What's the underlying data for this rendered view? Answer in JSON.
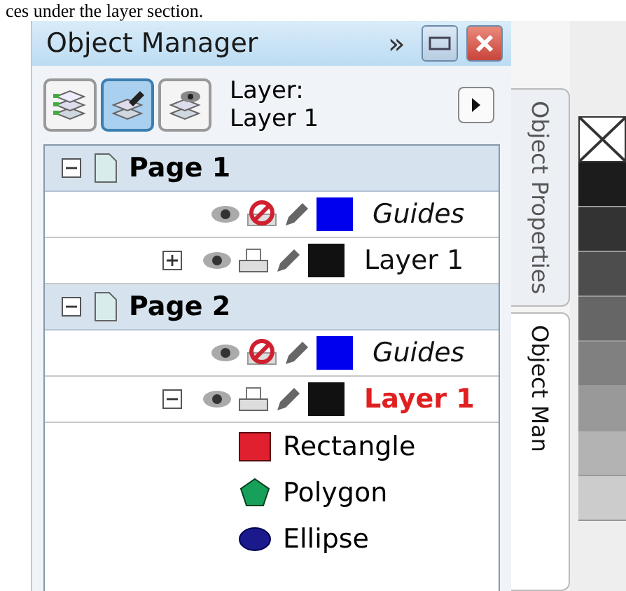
{
  "caption": "ces under the layer section.",
  "window": {
    "title": "Object Manager",
    "more": "»"
  },
  "toolbar": {
    "modes": [
      {
        "kind": "layers",
        "selected": false
      },
      {
        "kind": "edit",
        "selected": true
      },
      {
        "kind": "view",
        "selected": false
      }
    ],
    "layer_label": "Layer:",
    "layer_name": "Layer 1"
  },
  "tree": [
    {
      "name": "Page 1",
      "expanded": true,
      "children": [
        {
          "name": "Guides",
          "kind": "guides",
          "color": "#0000ee",
          "printable": false,
          "active": false
        },
        {
          "name": "Layer 1",
          "kind": "layer",
          "color": "#111111",
          "printable": true,
          "active": false,
          "expanded": false
        }
      ]
    },
    {
      "name": "Page 2",
      "expanded": true,
      "children": [
        {
          "name": "Guides",
          "kind": "guides",
          "color": "#0000ee",
          "printable": false,
          "active": false
        },
        {
          "name": "Layer 1",
          "kind": "layer",
          "color": "#111111",
          "printable": true,
          "active": true,
          "expanded": true,
          "children": [
            {
              "name": "Rectangle",
              "kind": "rectangle",
              "color": "#e0202e"
            },
            {
              "name": "Polygon",
              "kind": "polygon",
              "color": "#17a05a"
            },
            {
              "name": "Ellipse",
              "kind": "ellipse",
              "color": "#1a1a8c"
            }
          ]
        }
      ]
    }
  ],
  "side_tabs": [
    {
      "label": "Object Properties",
      "selected": false
    },
    {
      "label": "Object Man",
      "selected": true
    }
  ],
  "palette": [
    {
      "kind": "none"
    },
    {
      "kind": "swatch",
      "color": "#1c1c1c"
    },
    {
      "kind": "swatch",
      "color": "#333333"
    },
    {
      "kind": "swatch",
      "color": "#4d4d4d"
    },
    {
      "kind": "swatch",
      "color": "#666666"
    },
    {
      "kind": "swatch",
      "color": "#808080"
    },
    {
      "kind": "swatch",
      "color": "#999999"
    },
    {
      "kind": "swatch",
      "color": "#b3b3b3"
    },
    {
      "kind": "swatch",
      "color": "#cccccc"
    }
  ]
}
